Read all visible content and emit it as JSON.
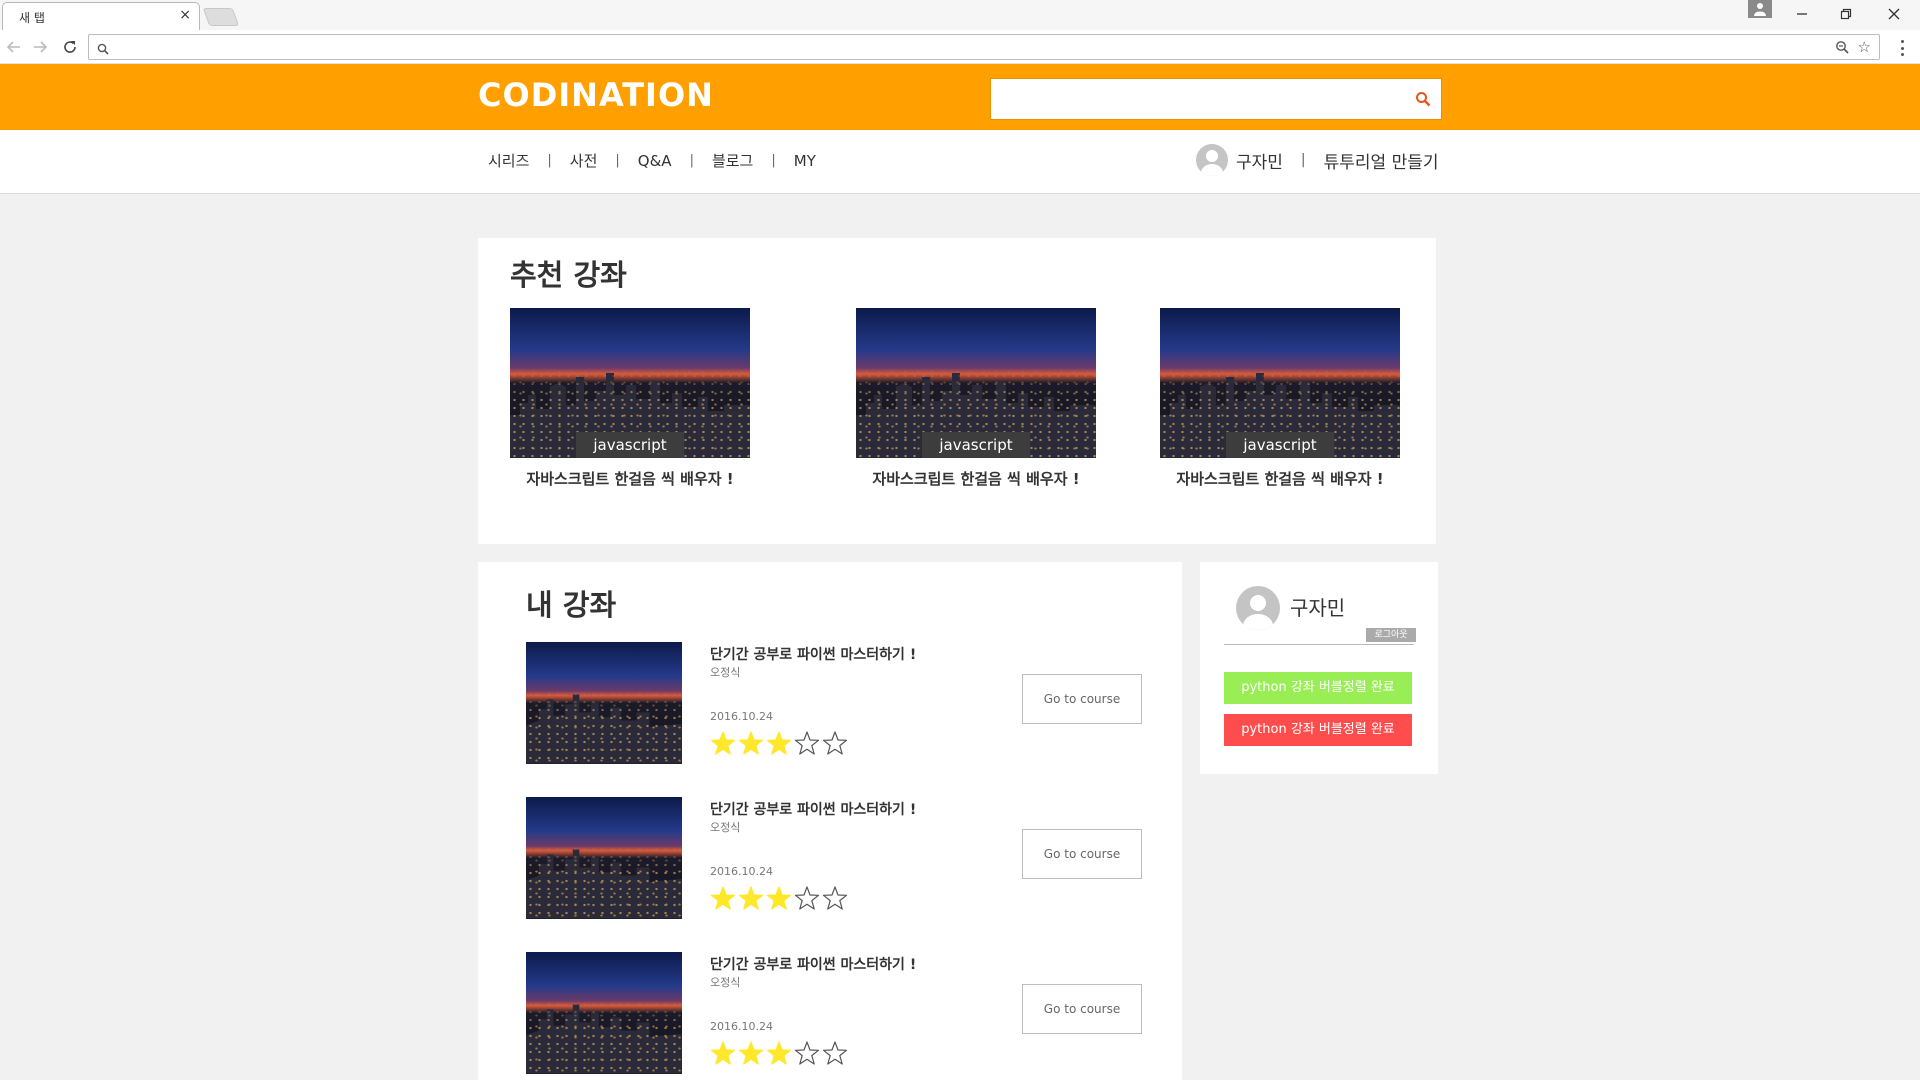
{
  "browser": {
    "tab_title": "새 탭",
    "tab_close": "×",
    "address_value": ""
  },
  "site": {
    "logo": "CODINATION",
    "search_placeholder": "",
    "menu": [
      "시리즈",
      "사전",
      "Q&A",
      "블로그",
      "MY"
    ],
    "menu_separator": "|",
    "user_name": "구자민",
    "create_tutorial": "튜투리얼 만들기"
  },
  "recommended": {
    "title": "추천 강좌",
    "cards": [
      {
        "tag": "javascript",
        "title": "자바스크립트 한걸음 씩 배우자 !"
      },
      {
        "tag": "javascript",
        "title": "자바스크립트 한걸음 씩 배우자 !"
      },
      {
        "tag": "javascript",
        "title": "자바스크립트 한걸음 씩 배우자 !"
      }
    ]
  },
  "my_courses": {
    "title": "내 강좌",
    "items": [
      {
        "title": "단기간 공부로 파이썬 마스터하기 !",
        "author": "오정식",
        "date": "2016.10.24",
        "rating": 3,
        "max_rating": 5,
        "button": "Go to course"
      },
      {
        "title": "단기간 공부로 파이썬 마스터하기 !",
        "author": "오정식",
        "date": "2016.10.24",
        "rating": 3,
        "max_rating": 5,
        "button": "Go to course"
      },
      {
        "title": "단기간 공부로 파이썬 마스터하기 !",
        "author": "오정식",
        "date": "2016.10.24",
        "rating": 3,
        "max_rating": 5,
        "button": "Go to course"
      }
    ]
  },
  "profile": {
    "name": "구자민",
    "logout": "로그아웃",
    "badges": [
      {
        "text": "python 강좌 버블정렬 완료",
        "color": "#99ee55"
      },
      {
        "text": "python 강좌 버블정렬 완료",
        "color": "#ff4d4d"
      }
    ]
  },
  "colors": {
    "brand": "#ff9f00",
    "star_filled": "#ffe82a",
    "tag_bg": "#3d3d3d"
  }
}
